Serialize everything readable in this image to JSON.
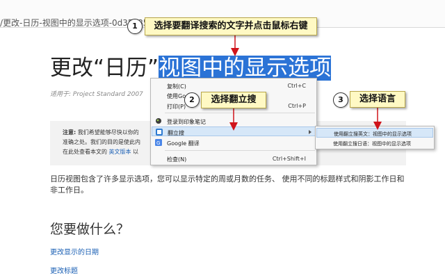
{
  "browser": {
    "url_text": "/更改-日历-视图中的显示选项-0d35c858-de"
  },
  "page": {
    "title_prefix": "更改“日历”",
    "title_selected": "视图中的显示选项",
    "applies_to": "适用于: Project Standard 2007",
    "note": {
      "label": "注意:",
      "line1": " 我们希望能够尽快以你的",
      "line2": "准确之处。我们的目的是使此内",
      "line3a": "在此处查看本文的 ",
      "line3_link": "英文版本",
      "line3b": " 以"
    },
    "body": "日历视图包含了许多显示选项，您可以显示特定的周或月数的任务、 使用不同的标题样式和阴影工作日和非工作日。",
    "section_heading": "您要做什么？",
    "links": [
      "更改显示的日期",
      "更改标题"
    ]
  },
  "context_menu": {
    "items": [
      {
        "label": "复制(C)",
        "shortcut": "Ctrl+C"
      },
      {
        "label": "使用Go",
        "shortcut": ""
      },
      {
        "label": "打印(P)",
        "shortcut": "Ctrl+P"
      },
      {
        "label": "登录到印象笔记",
        "shortcut": ""
      },
      {
        "label": "翻立搜",
        "shortcut": ""
      },
      {
        "label": "Google 翻译",
        "shortcut": ""
      },
      {
        "label": "检查(N)",
        "shortcut": "Ctrl+Shift+I"
      }
    ]
  },
  "submenu": {
    "items": [
      "使用翻立搜英文：视图中的显示选项",
      "使用翻立搜日语：视图中的显示选项"
    ]
  },
  "annotations": {
    "step1_number": "1",
    "step1_text": "选择要翻译搜索的文字并点击鼠标右键",
    "step2_number": "2",
    "step2_text": "选择翻立搜",
    "step3_number": "3",
    "step3_text": "选择语言"
  },
  "colors": {
    "selection": "#2b73d6",
    "link": "#1a5fb4",
    "callout_bg": "#fff9c4",
    "arrow_red": "#d0141b",
    "menu_highlight": "#d6e7f8"
  }
}
